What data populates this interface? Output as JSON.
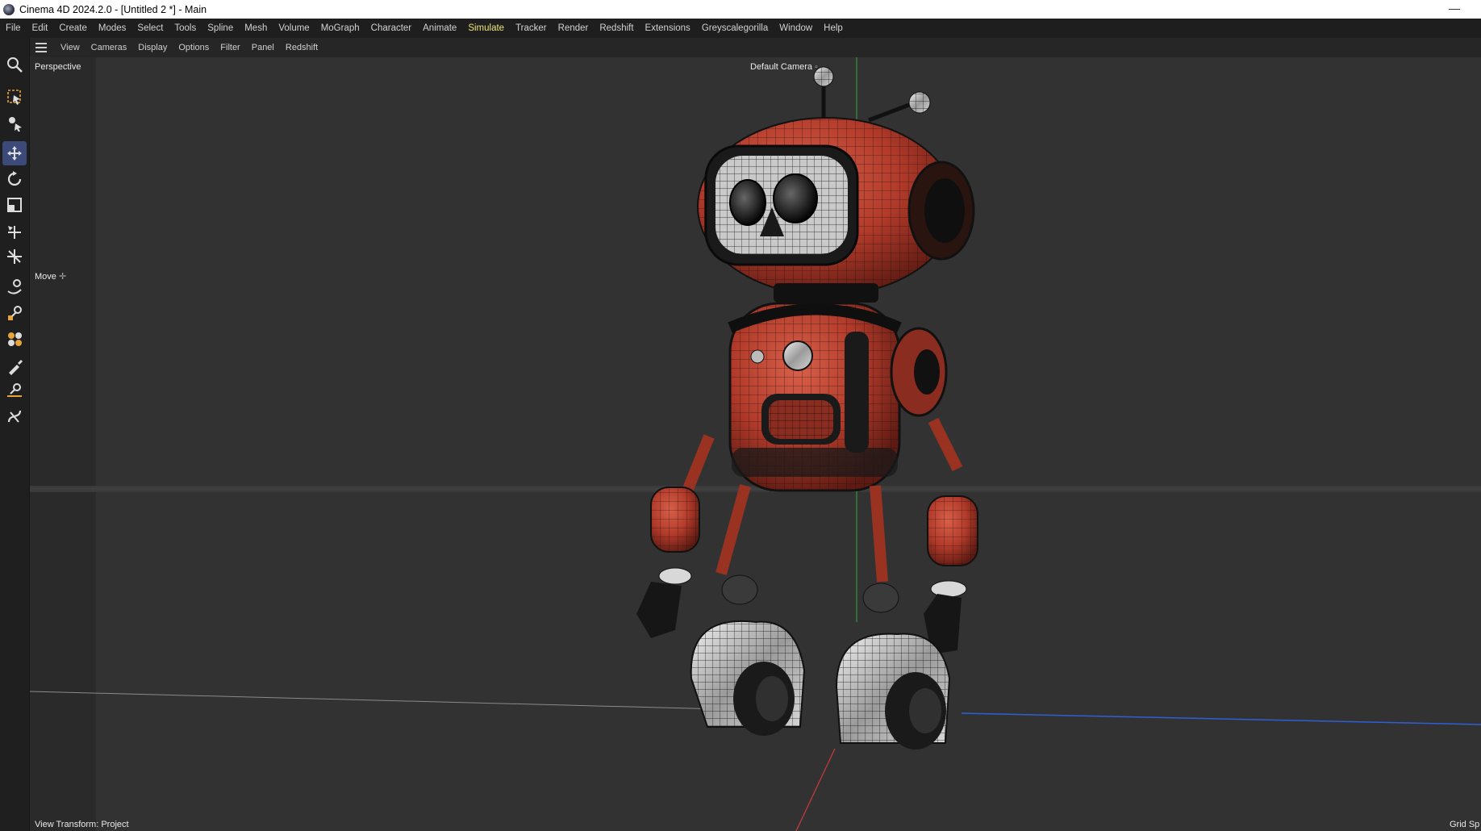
{
  "window": {
    "title": "Cinema 4D 2024.2.0 - [Untitled 2 *] - Main",
    "minimize_glyph": "—"
  },
  "menubar": {
    "items": [
      {
        "label": "File"
      },
      {
        "label": "Edit"
      },
      {
        "label": "Create"
      },
      {
        "label": "Modes"
      },
      {
        "label": "Select"
      },
      {
        "label": "Tools"
      },
      {
        "label": "Spline"
      },
      {
        "label": "Mesh"
      },
      {
        "label": "Volume"
      },
      {
        "label": "MoGraph"
      },
      {
        "label": "Character"
      },
      {
        "label": "Animate"
      },
      {
        "label": "Simulate",
        "active": true
      },
      {
        "label": "Tracker"
      },
      {
        "label": "Render"
      },
      {
        "label": "Redshift"
      },
      {
        "label": "Extensions"
      },
      {
        "label": "Greyscalegorilla"
      },
      {
        "label": "Window"
      },
      {
        "label": "Help"
      }
    ],
    "accent_color": "#e9e27a"
  },
  "viewport_menu": {
    "items": [
      "View",
      "Cameras",
      "Display",
      "Options",
      "Filter",
      "Panel",
      "Redshift"
    ]
  },
  "toolbar": {
    "tools": [
      {
        "icon": "search-icon"
      },
      {
        "icon": "live-selection-icon"
      },
      {
        "icon": "object-mode-icon"
      },
      {
        "icon": "move-icon",
        "active": true
      },
      {
        "icon": "rotate-icon"
      },
      {
        "icon": "scale-icon"
      },
      {
        "icon": "transform-icon"
      },
      {
        "icon": "axis-move-icon"
      },
      {
        "icon": "spline-pen-icon"
      },
      {
        "icon": "sketch-icon"
      },
      {
        "icon": "mograph-cloner-icon"
      },
      {
        "icon": "brush-icon"
      },
      {
        "icon": "line-pen-icon"
      },
      {
        "icon": "spline-tool-icon"
      }
    ],
    "active_color": "#3b4a78"
  },
  "viewport": {
    "projection": "Perspective",
    "camera": "Default Camera",
    "tool_label": "Move",
    "view_transform": "View Transform: Project",
    "grid_label": "Grid Sp",
    "scene_subject": "robot-model",
    "colors": {
      "background": "#323232",
      "x_axis": "#c23a3a",
      "y_axis": "#2f9a3d",
      "z_axis": "#2f5fd6",
      "robot_body": "#b13a2a"
    }
  }
}
